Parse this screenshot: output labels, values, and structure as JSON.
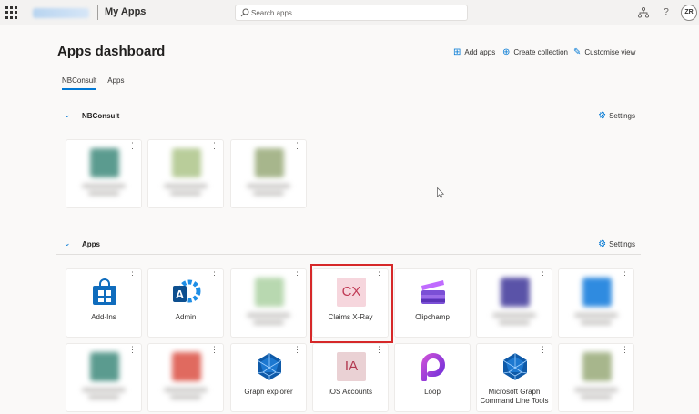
{
  "topbar": {
    "brand": "My Apps",
    "search_placeholder": "Search apps",
    "avatar_initials": "ZR",
    "help_glyph": "?"
  },
  "header": {
    "title": "Apps dashboard",
    "actions": [
      "Add apps",
      "Create collection",
      "Customise view"
    ]
  },
  "tabs": [
    "NBConsult",
    "Apps"
  ],
  "sections": [
    {
      "name": "NBConsult",
      "settings_label": "Settings",
      "tiles": [
        {
          "label": "",
          "blurred": true,
          "color": "#5b9b8f"
        },
        {
          "label": "",
          "blurred": true,
          "color": "#b9cd9a"
        },
        {
          "label": "",
          "blurred": true,
          "color": "#a7b68c"
        }
      ]
    },
    {
      "name": "Apps",
      "settings_label": "Settings",
      "tiles": [
        {
          "label": "Add-Ins",
          "icon": "store-bag-icon",
          "color": "#0f6cbd"
        },
        {
          "label": "Admin",
          "icon": "admin-gear-icon",
          "color": "#1e8ee6"
        },
        {
          "label": "",
          "blurred": true,
          "color": "#b8d8b0"
        },
        {
          "label": "Claims X-Ray",
          "icon": "text-tile",
          "icon_text": "CX",
          "color": "#f6d6dd",
          "text_color": "#c03a55"
        },
        {
          "label": "Clipchamp",
          "icon": "clipchamp-icon",
          "color": "#7b4fd6"
        },
        {
          "label": "",
          "blurred": true,
          "color": "#5a53a8"
        },
        {
          "label": "",
          "blurred": true,
          "color": "#2f8be0"
        },
        {
          "label": "",
          "blurred": true,
          "color": "#5b9b8f"
        },
        {
          "label": "",
          "blurred": true,
          "color": "#e06a5f"
        },
        {
          "label": "Graph explorer",
          "icon": "graph-polyhedron-icon",
          "color": "#0f5aa8"
        },
        {
          "label": "iOS Accounts",
          "icon": "text-tile",
          "icon_text": "IA",
          "color": "#ead1d4",
          "text_color": "#b2384f"
        },
        {
          "label": "Loop",
          "icon": "loop-icon",
          "color": "#6e2fd9"
        },
        {
          "label": "Microsoft Graph Command Line Tools",
          "icon": "graph-polyhedron-icon",
          "color": "#0f5aa8"
        },
        {
          "label": "",
          "blurred": true,
          "color": "#a7b68c"
        }
      ]
    }
  ]
}
